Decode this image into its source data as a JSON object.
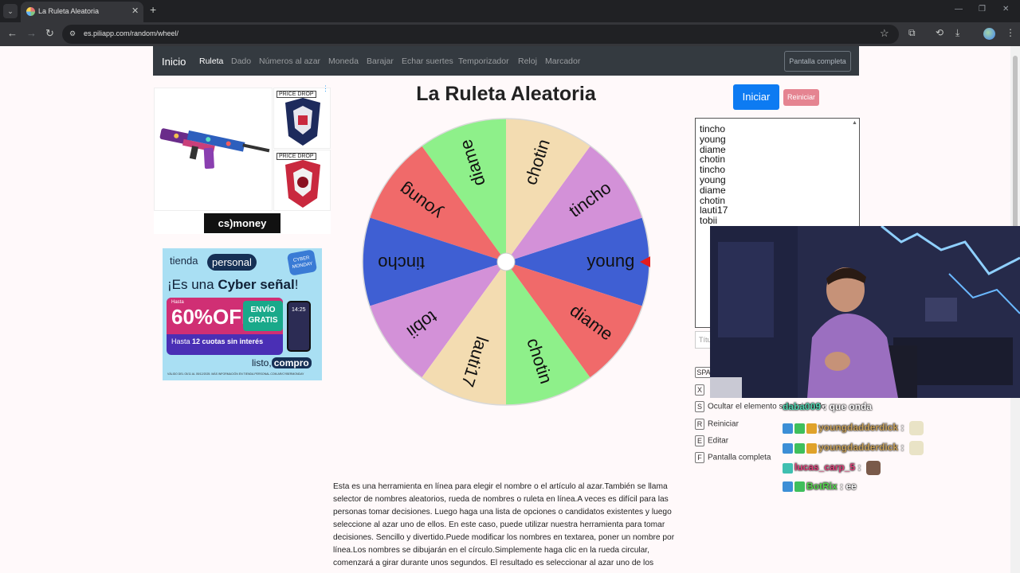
{
  "browser": {
    "tab_title": "La Ruleta Aleatoria",
    "url": "es.piliapp.com/random/wheel/"
  },
  "site_nav": {
    "brand": "Inicio",
    "links": [
      "Ruleta",
      "Dado",
      "Números al azar",
      "Moneda",
      "Barajar",
      "Echar suertes",
      "Temporizador",
      "Reloj",
      "Marcador"
    ],
    "active": "Ruleta",
    "fullscreen_button": "Pantalla completa"
  },
  "ads": {
    "top": {
      "price_drop": "PRICE DROP",
      "logo": "cs)money"
    },
    "bottom": {
      "brand": "tienda",
      "brand_word": "personal",
      "badge": "CYBER MONDAY",
      "headline_pre": "¡Es una ",
      "headline_bold": "Cyber señal",
      "headline_post": "!",
      "hasta": "Hasta",
      "discount": "60%OFF",
      "envio": "ENVÍO GRATIS",
      "cuotas": "12 cuotas sin interés",
      "cuotas_prefix": "Hasta",
      "phone_time": "14:25",
      "listo": "listo,",
      "compro": "compro",
      "legal": "VÁLIDO DEL 03/11 AL 05/12/2025. MÁS INFORMACIÓN EN TIENDA.PERSONAL.COM.AR/CYBERMONDAY"
    }
  },
  "wheel": {
    "title": "La Ruleta Aleatoria",
    "segments": [
      {
        "label": "young",
        "color": "#3f5fd3"
      },
      {
        "label": "tincho",
        "color": "#d391d8"
      },
      {
        "label": "chotin",
        "color": "#f3dcb1"
      },
      {
        "label": "diame",
        "color": "#8ef08a"
      },
      {
        "label": "young",
        "color": "#f06a6a"
      },
      {
        "label": "tincho",
        "color": "#3f5fd3"
      },
      {
        "label": "tobii",
        "color": "#d391d8"
      },
      {
        "label": "lauti17",
        "color": "#f3dcb1"
      },
      {
        "label": "chotin",
        "color": "#8ef08a"
      },
      {
        "label": "diame",
        "color": "#f06a6a"
      }
    ],
    "pointer_color": "#e41c1c"
  },
  "controls": {
    "start_label": "Iniciar",
    "reset_label": "Reiniciar",
    "names": [
      "tincho",
      "young",
      "diame",
      "chotin",
      "tincho",
      "young",
      "diame",
      "chotin",
      "lauti17",
      "tobii"
    ],
    "title_placeholder": "Títu",
    "shortcuts": [
      {
        "key": "SPA",
        "label": ""
      },
      {
        "key": "X",
        "label": ""
      },
      {
        "key": "S",
        "label": "Ocultar el elemento seleccionado"
      },
      {
        "key": "R",
        "label": "Reiniciar"
      },
      {
        "key": "E",
        "label": "Editar"
      },
      {
        "key": "F",
        "label": "Pantalla completa"
      }
    ]
  },
  "description": "Esta es una herramienta en línea para elegir el nombre o el artículo al azar.También se llama selector de nombres aleatorios, rueda de nombres o ruleta en línea.A veces es difícil para las personas tomar decisiones. Luego haga una lista de opciones o candidatos existentes y luego seleccione al azar uno de ellos. En este caso, puede utilizar nuestra herramienta para tomar decisiones. Sencillo y divertido.Puede modificar los nombres en textarea, poner un nombre por línea.Los nombres se dibujarán en el círculo.Simplemente haga clic en la rueda circular, comenzará a girar durante unos segundos. El resultado es seleccionar al azar uno de los",
  "chat": [
    {
      "user": "daba009",
      "message": "que onda",
      "user_color": "#4fd6b0",
      "badges": []
    },
    {
      "user": "youngdadderdick",
      "message": "",
      "user_color": "#c9a15a",
      "badges": [
        "#3c8fd6",
        "#3fbf5c",
        "#e0a22a"
      ],
      "emote": "light"
    },
    {
      "user": "youngdadderdick",
      "message": "",
      "user_color": "#c9a15a",
      "badges": [
        "#3c8fd6",
        "#3fbf5c",
        "#e0a22a"
      ],
      "emote": "light"
    },
    {
      "user": "lucas_carp_5",
      "message": "",
      "user_color": "#e0407a",
      "badges": [
        "#3fbfb0"
      ],
      "emote": "dark"
    },
    {
      "user": "BotRix",
      "message": "ee",
      "user_color": "#55d64f",
      "badges": [
        "#3c8fd6",
        "#3fbf5c"
      ]
    }
  ]
}
